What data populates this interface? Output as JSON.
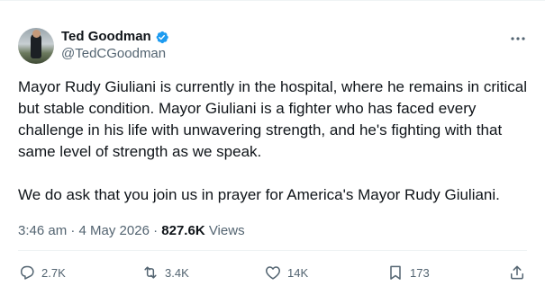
{
  "colors": {
    "text": "#0f1419",
    "muted": "#536471",
    "verified": "#1d9bf0",
    "divider": "#eff3f4"
  },
  "author": {
    "name": "Ted Goodman",
    "handle": "@TedCGoodman",
    "verified_icon": "verified-badge-icon",
    "avatar_icon": "profile-photo"
  },
  "tweet": {
    "paragraph_1": "Mayor Rudy Giuliani is currently in the hospital, where he remains in critical but stable condition. Mayor Giuliani is a fighter who has faced every challenge in his life with unwavering strength, and he's fighting with that same level of strength as we speak.",
    "paragraph_2": "We do ask that you join us in prayer for America's Mayor Rudy Giuliani.",
    "time": "3:46 am",
    "separator": "·",
    "date": "4 May 2026",
    "views_count": "827.6K",
    "views_label": "Views"
  },
  "actions": {
    "replies": "2.7K",
    "reposts": "3.4K",
    "likes": "14K",
    "bookmarks": "173"
  }
}
